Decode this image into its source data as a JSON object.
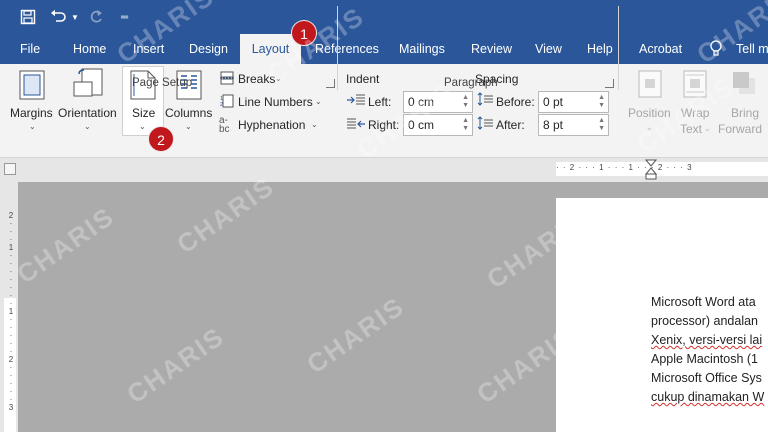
{
  "title_bar": {
    "qat": [
      "save-icon",
      "undo-icon",
      "redo-icon",
      "customize-qat-icon"
    ]
  },
  "tabs": [
    {
      "label": "File"
    },
    {
      "label": "Home"
    },
    {
      "label": "Insert"
    },
    {
      "label": "Design"
    },
    {
      "label": "Layout",
      "active": true
    },
    {
      "label": "References"
    },
    {
      "label": "Mailings"
    },
    {
      "label": "Review"
    },
    {
      "label": "View"
    },
    {
      "label": "Help"
    },
    {
      "label": "Acrobat"
    },
    {
      "label": "Tell m"
    }
  ],
  "ribbon": {
    "page_setup": {
      "margins": "Margins",
      "orientation": "Orientation",
      "size": "Size",
      "columns": "Columns",
      "breaks": "Breaks",
      "line_numbers": "Line Numbers",
      "hyphenation": "Hyphenation",
      "group_label": "Page Setup"
    },
    "paragraph": {
      "indent_title": "Indent",
      "spacing_title": "Spacing",
      "left_label": "Left:",
      "left_value": "0 cm",
      "right_label": "Right:",
      "right_value": "0 cm",
      "before_label": "Before:",
      "before_value": "0 pt",
      "after_label": "After:",
      "after_value": "8 pt",
      "group_label": "Paragraph"
    },
    "arrange": {
      "position": "Position",
      "wrap_text_1": "Wrap",
      "wrap_text_2": "Text",
      "bring_forward_1": "Bring",
      "bring_forward_2": "Forward"
    }
  },
  "badges": {
    "one": "1",
    "two": "2"
  },
  "ruler": {
    "h_ticks": [
      "2",
      "1",
      "1",
      "2",
      "3"
    ],
    "v_ticks": [
      "2",
      "1",
      "1",
      "2",
      "3"
    ]
  },
  "document": {
    "lines": [
      "Microsoft Word ata",
      "processor) andalan",
      "Xenix, versi-versi lai",
      "Apple Macintosh (1",
      "Microsoft Office Sys",
      "cukup dinamakan W"
    ]
  },
  "watermark": "CHARIS",
  "colors": {
    "brand": "#2b579a",
    "badge": "#c0181c"
  }
}
